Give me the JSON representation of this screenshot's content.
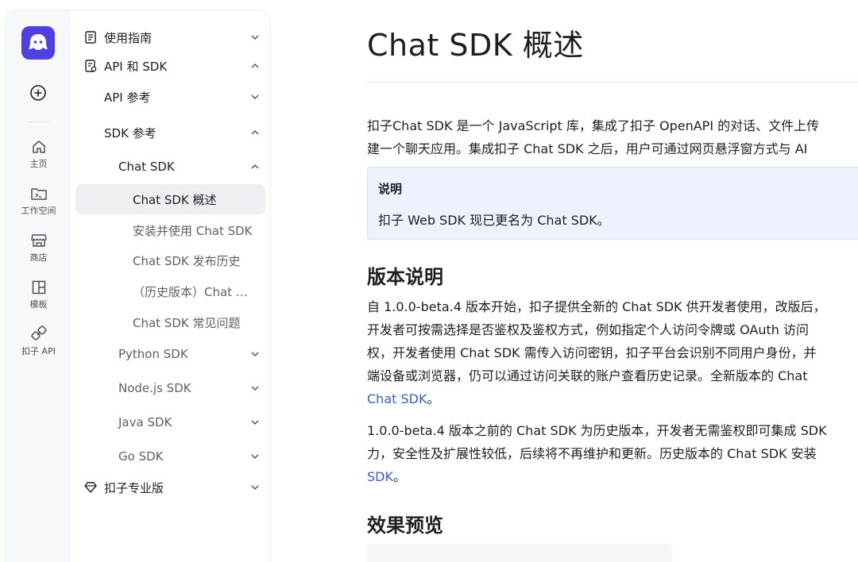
{
  "rail": {
    "items": [
      {
        "label": "主页",
        "icon": "home-icon"
      },
      {
        "label": "工作空间",
        "icon": "terminal-folder-icon"
      },
      {
        "label": "商店",
        "icon": "store-icon"
      },
      {
        "label": "模板",
        "icon": "template-icon"
      },
      {
        "label": "扣子 API",
        "icon": "api-link-icon"
      }
    ]
  },
  "sidebar": {
    "items": [
      {
        "label": "使用指南",
        "icon": "doc-icon",
        "expanded": false
      },
      {
        "label": "API 和 SDK",
        "icon": "api-doc-icon",
        "expanded": true
      },
      {
        "label": "API 参考",
        "expanded": false
      },
      {
        "label": "SDK 参考",
        "expanded": true
      },
      {
        "label": "Chat SDK",
        "expanded": true
      },
      {
        "label": "Chat SDK 概述",
        "active": true
      },
      {
        "label": "安装并使用 Chat SDK"
      },
      {
        "label": "Chat SDK 发布历史"
      },
      {
        "label": "（历史版本）Chat …"
      },
      {
        "label": "Chat SDK 常见问题"
      },
      {
        "label": "Python SDK",
        "expanded": false
      },
      {
        "label": "Node.js SDK",
        "expanded": false
      },
      {
        "label": "Java SDK",
        "expanded": false
      },
      {
        "label": "Go SDK",
        "expanded": false
      },
      {
        "label": "扣子专业版",
        "icon": "diamond-icon",
        "expanded": false
      }
    ]
  },
  "content": {
    "title": "Chat SDK 概述",
    "intro": [
      "扣子Chat SDK 是一个 JavaScript 库，集成了扣子 OpenAPI 的对话、文件上传",
      "建一个聊天应用。集成扣子 Chat SDK 之后，用户可通过网页悬浮窗方式与 AI"
    ],
    "note": {
      "title": "说明",
      "body": "扣子 Web SDK 现已更名为 Chat SDK。"
    },
    "section1": {
      "heading": "版本说明",
      "lines": [
        "自 1.0.0-beta.4 版本开始，扣子提供全新的 Chat SDK 供开发者使用，改版后，",
        "开发者可按需选择是否鉴权及鉴权方式，例如指定个人访问令牌或 OAuth 访问",
        "权，开发者使用 Chat SDK 需传入访问密钥，扣子平台会识别不同用户身份，并",
        "端设备或浏览器，仍可以通过访问关联的账户查看历史记录。全新版本的 Chat"
      ],
      "link_text": "Chat SDK",
      "link_suffix": "。",
      "lines2": [
        " 1.0.0-beta.4 版本之前的 Chat SDK 为历史版本，开发者无需鉴权即可集成 SDK",
        "力，安全性及扩展性较低，后续将不再维护和更新。历史版本的 Chat SDK 安装"
      ],
      "link2_text": "SDK",
      "link2_suffix": "。"
    },
    "section2": {
      "heading": "效果预览"
    }
  }
}
